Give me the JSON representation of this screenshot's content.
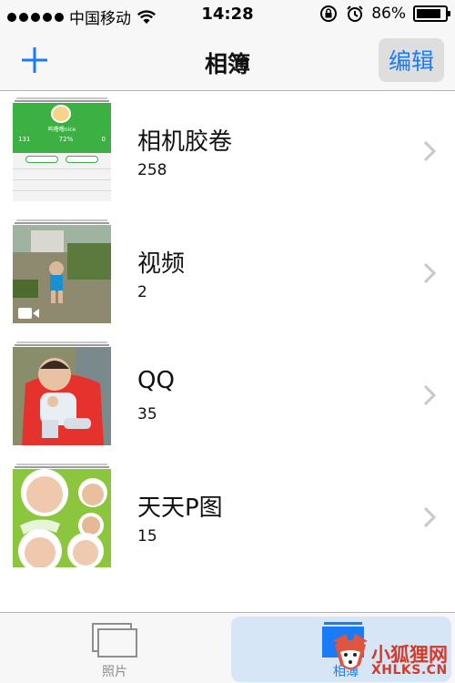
{
  "status_bar": {
    "carrier": "中国移动",
    "time": "14:28",
    "battery": "86%",
    "battery_level": 0.86
  },
  "nav": {
    "title": "相簿",
    "edit_label": "编辑"
  },
  "albums": [
    {
      "name": "相机胶卷",
      "count": "258"
    },
    {
      "name": "视频",
      "count": "2"
    },
    {
      "name": "QQ",
      "count": "35"
    },
    {
      "name": "天天P图",
      "count": "15"
    }
  ],
  "thumb1": {
    "user": "呜噜噜nice",
    "stats": [
      "131",
      "72%",
      "0"
    ]
  },
  "tabs": {
    "photos_label": "照片",
    "albums_label": "相簿"
  },
  "watermark": {
    "cn": "小狐狸网",
    "en": "XHLKS.CN"
  },
  "colors": {
    "accent": "#1a7cf5",
    "bar_bg": "#f7f7f7",
    "watermark": "#d43a2a"
  }
}
